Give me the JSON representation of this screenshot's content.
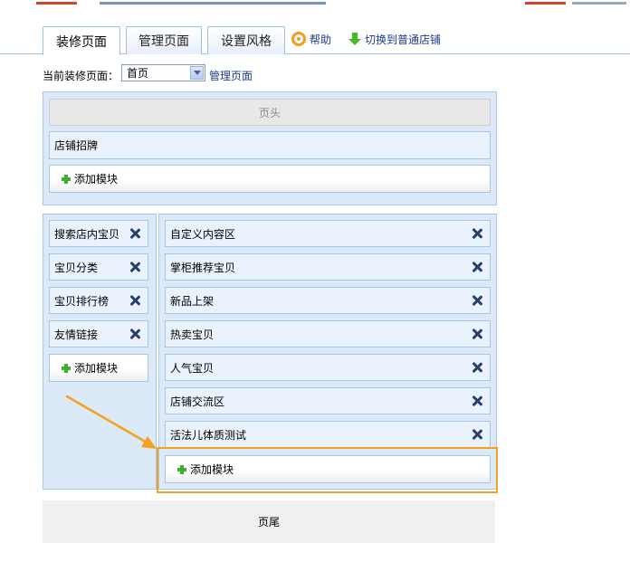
{
  "tabs": [
    {
      "label": "装修页面",
      "active": true
    },
    {
      "label": "管理页面",
      "active": false
    },
    {
      "label": "设置风格",
      "active": false
    }
  ],
  "toolbar": {
    "help_label": "帮助",
    "switch_label": "切换到普通店铺"
  },
  "page_selector": {
    "label": "当前装修页面：",
    "selected": "首页",
    "manage_link": "管理页面"
  },
  "header_region": {
    "title": "页头",
    "shop_sign": "店铺招牌",
    "add_module": "添加模块"
  },
  "left_column": {
    "modules": [
      "搜索店内宝贝",
      "宝贝分类",
      "宝贝排行榜",
      "友情链接"
    ],
    "add_module": "添加模块"
  },
  "main_column": {
    "modules": [
      "自定义内容区",
      "掌柜推荐宝贝",
      "新品上架",
      "热卖宝贝",
      "人气宝贝",
      "店铺交流区",
      "活法儿体质测试"
    ],
    "add_module": "添加模块"
  },
  "footer": {
    "title": "页尾"
  },
  "colors": {
    "accent": "#f4a21c",
    "panel_bg": "#dbe9f9",
    "border": "#a7c7ea",
    "link": "#1a3c8c",
    "plus": "#3fae28"
  },
  "icons": [
    "help-icon",
    "arrow-down-icon",
    "chevron-down-icon",
    "plus-icon",
    "close-icon"
  ]
}
